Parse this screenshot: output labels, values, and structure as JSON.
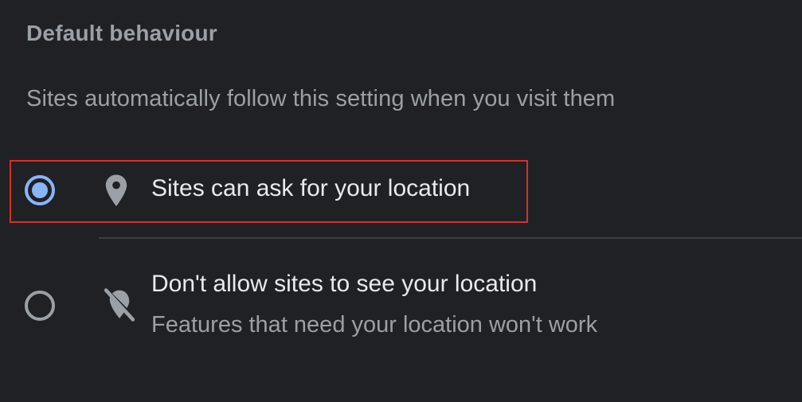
{
  "section": {
    "heading": "Default behaviour",
    "description": "Sites automatically follow this setting when you visit them"
  },
  "options": [
    {
      "label": "Sites can ask for your location",
      "icon": "location-pin-icon",
      "selected": true,
      "highlighted": true
    },
    {
      "label": "Don't allow sites to see your location",
      "sublabel": "Features that need your location won't work",
      "icon": "location-off-icon",
      "selected": false
    }
  ],
  "colors": {
    "background": "#202124",
    "accent": "#8ab4f8",
    "text_primary": "#e8eaed",
    "text_secondary": "#9aa0a6",
    "highlight": "#d93025"
  }
}
